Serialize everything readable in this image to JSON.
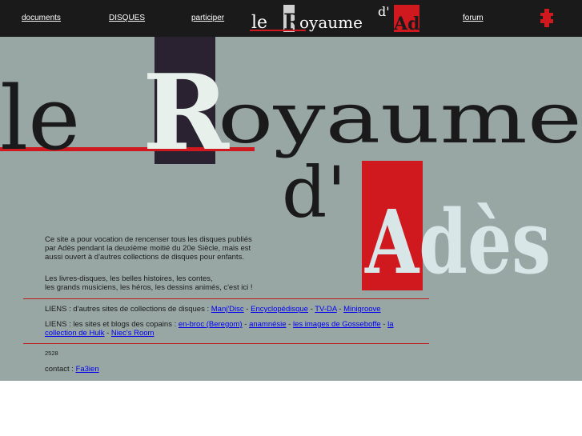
{
  "nav": {
    "documents": "documents",
    "disques": "DISQUES",
    "participer": "participer",
    "forum": "forum"
  },
  "logo": {
    "small": {
      "le": "le",
      "r": "R",
      "oyaume": "oyaume",
      "d": "d'",
      "ades": "Adès"
    },
    "big": {
      "le": "le",
      "r": "R",
      "oyaume": "oyaume",
      "d": "d'",
      "ades": "Adès"
    }
  },
  "intro": {
    "line1": "Ce site a pour vocation de rencenser tous les disques publiés",
    "line2": "par Adès pendant la deuxième moitié du 20e Siècle, mais est",
    "line3": "aussi ouvert à d'autres collections de disques pour enfants.",
    "line4": "Les livres-disques, les belles histoires, les contes,",
    "line5": "les grands musiciens, les héros, les dessins animés, c'est ici !"
  },
  "liens1": {
    "prefix": "LIENS : d'autres sites de collections de disques : ",
    "links": [
      "Manj'Disc",
      "Encyclopédisque",
      "TV-DA",
      "Minigroove"
    ],
    "sep": " - "
  },
  "liens2": {
    "prefix": "LIENS : les sites et blogs des copains : ",
    "links": [
      "en-broc (Beregom)",
      "anamnésie",
      "les images de Gosseboffe",
      "la collection de Hulk",
      "Niec's Room"
    ],
    "sep": " - "
  },
  "counter": "2528",
  "contact": {
    "label": "contact : ",
    "link": "Fa3ien"
  },
  "colors": {
    "topbar": "#1a1a1a",
    "background": "#98a7a4",
    "red": "#d0191f",
    "dark_block": "#2a2230",
    "link": "#0000ee"
  }
}
